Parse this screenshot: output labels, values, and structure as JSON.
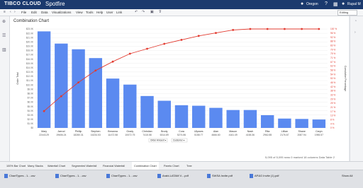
{
  "app": {
    "brand": "TIBCO CLOUD",
    "product": "Spotfire",
    "location": "Oregon",
    "user": "Rupal M",
    "mode": "Editing"
  },
  "menu": [
    "File",
    "Edit",
    "Data",
    "Visualizations",
    "View",
    "Tools",
    "Help",
    "User",
    "Link"
  ],
  "chart_title": "Combination Chart",
  "selectors": {
    "x_axis": "Customer",
    "y_axis_left": "Order Total",
    "y_axis_right": "Cumulative Percentage",
    "color": "Order Amount"
  },
  "chart_data": {
    "type": "bar",
    "categories": [
      "Mary",
      "Jarrod",
      "Phillip",
      "Stephen",
      "Breanna",
      "Grady",
      "Christian",
      "Brody",
      "Cora",
      "Ulysses",
      "Alan",
      "Mason",
      "Nash",
      "Rita",
      "Lillian",
      "Shane",
      "Caryn"
    ],
    "series": [
      {
        "values": [
          22443.29,
          19606.24,
          18280.31,
          16234.53,
          11472.58,
          10072.75,
          7415.58,
          6314.89,
          5274.86,
          5158.77,
          4666.6,
          4161.49,
          4165.36,
          2962.85,
          2176.67,
          2087.94,
          1955.57
        ]
      },
      {
        "axis": "right",
        "type": "line",
        "values": [
          17,
          32,
          46,
          58,
          67,
          75,
          80,
          85,
          89,
          93,
          96,
          99,
          100,
          100,
          100,
          100,
          100
        ]
      }
    ],
    "value_labels": [
      "22443.29",
      "19606.24",
      "18280.31",
      "16234.53",
      "11472.58",
      "10072.75",
      "7415.58",
      "6314.89",
      "5274.86",
      "5158.77",
      "4666.60",
      "4161.49",
      "4165.36",
      "2962.85",
      "2176.67",
      "2087.94",
      "1955.57"
    ],
    "y_ticks_left": [
      "$0",
      "$1.0K",
      "$2.0K",
      "$3.0K",
      "$4.0K",
      "$5.0K",
      "$6.0K",
      "$7.0K",
      "$8.0K",
      "$9.0K",
      "$10.0K",
      "$11.0K",
      "$12.0K",
      "$13.0K",
      "$14.0K",
      "$15.0K",
      "$16.0K",
      "$17.0K",
      "$18.0K",
      "$19.0K",
      "$20.0K",
      "$21.0K",
      "$22.0K",
      "$23.0K"
    ],
    "y_ticks_right": [
      "0 %",
      "4 %",
      "8 %",
      "13 %",
      "17 %",
      "21 %",
      "25 %",
      "29 %",
      "33 %",
      "38 %",
      "42 %",
      "46 %",
      "50 %",
      "54 %",
      "58 %",
      "63 %",
      "67 %",
      "71 %",
      "75 %",
      "79 %",
      "83 %",
      "88 %",
      "92 %",
      "96 %",
      "100 %"
    ],
    "ylim": [
      0,
      23000
    ],
    "ylim_right": [
      0,
      100
    ],
    "colors": {
      "bar": "#5b8af0",
      "line": "#e23b30",
      "grid": "#eeeeee"
    }
  },
  "status": "5,095 of 5,095 rows    0 marked    18 columns    Data Table 2",
  "tabs": [
    "100% Bar Chart",
    "Many Stacks",
    "Waterfall Chart",
    "Segmented Waterfall",
    "Financial Waterfall",
    "Combination Chart",
    "Pareto Chart",
    "Tree"
  ],
  "active_tab": "Combination Chart",
  "downloads": [
    "ChartTypes - 1....csv",
    "ChartTypes - 1....csv",
    "ChartTypes - 1....csv",
    "Arabi-LATAM V....pdf",
    "SWSA Invite.pdf",
    "AP&G Invite (1).pdf"
  ],
  "show_all": "Show All"
}
